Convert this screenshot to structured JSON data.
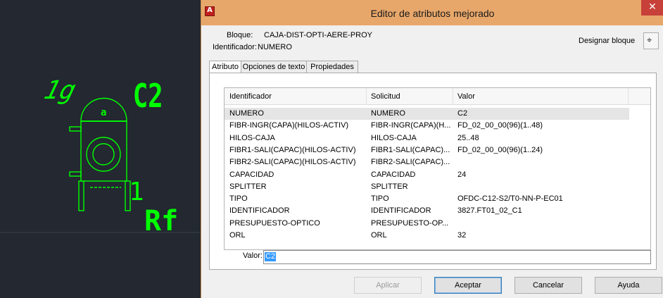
{
  "cad": {
    "labels": {
      "big_label": "C2",
      "left_label": "1g",
      "dome_label": "a",
      "right_digit": "1",
      "bottom_label": "Rf"
    },
    "stroke_color": "#00ff00"
  },
  "dialog": {
    "title": "Editor de atributos mejorado",
    "close_symbol": "✕",
    "block_label": "Bloque:",
    "block_value": "CAJA-DIST-OPTI-AERE-PROY",
    "ident_label": "Identificador:",
    "ident_value": "NUMERO",
    "designate_label": "Designar bloque",
    "tabs": [
      "Atributo",
      "Opciones de texto",
      "Propiedades"
    ],
    "table": {
      "headers": [
        "Identificador",
        "Solicitud",
        "Valor"
      ],
      "rows": [
        [
          "NUMERO",
          "NUMERO",
          "C2"
        ],
        [
          "FIBR-INGR(CAPA)(HILOS-ACTIV)",
          "FIBR-INGR(CAPA)(H...",
          "FD_02_00_00(96)(1..48)"
        ],
        [
          "HILOS-CAJA",
          "HILOS-CAJA",
          "25..48"
        ],
        [
          "FIBR1-SALI(CAPAC)(HILOS-ACTIV)",
          "FIBR1-SALI(CAPAC)...",
          "FD_02_00_00(96)(1..24)"
        ],
        [
          "FIBR2-SALI(CAPAC)(HILOS-ACTIV)",
          "FIBR2-SALI(CAPAC)...",
          ""
        ],
        [
          "CAPACIDAD",
          "CAPACIDAD",
          "24"
        ],
        [
          "SPLITTER",
          "SPLITTER",
          ""
        ],
        [
          "TIPO",
          "TIPO",
          "OFDC-C12-S2/T0-NN-P-EC01"
        ],
        [
          "IDENTIFICADOR",
          "IDENTIFICADOR",
          "3827.FT01_02_C1"
        ],
        [
          "PRESUPUESTO-OPTICO",
          "PRESUPUESTO-OP...",
          ""
        ],
        [
          "ORL",
          "ORL",
          "32"
        ]
      ]
    },
    "value_label": "Valor:",
    "value_input": "C2",
    "buttons": {
      "apply": "Aplicar",
      "ok": "Aceptar",
      "cancel": "Cancelar",
      "help": "Ayuda"
    },
    "colors": {
      "titlebar": "#e8a76a",
      "close": "#c7403a",
      "selection": "#3399ff"
    }
  }
}
